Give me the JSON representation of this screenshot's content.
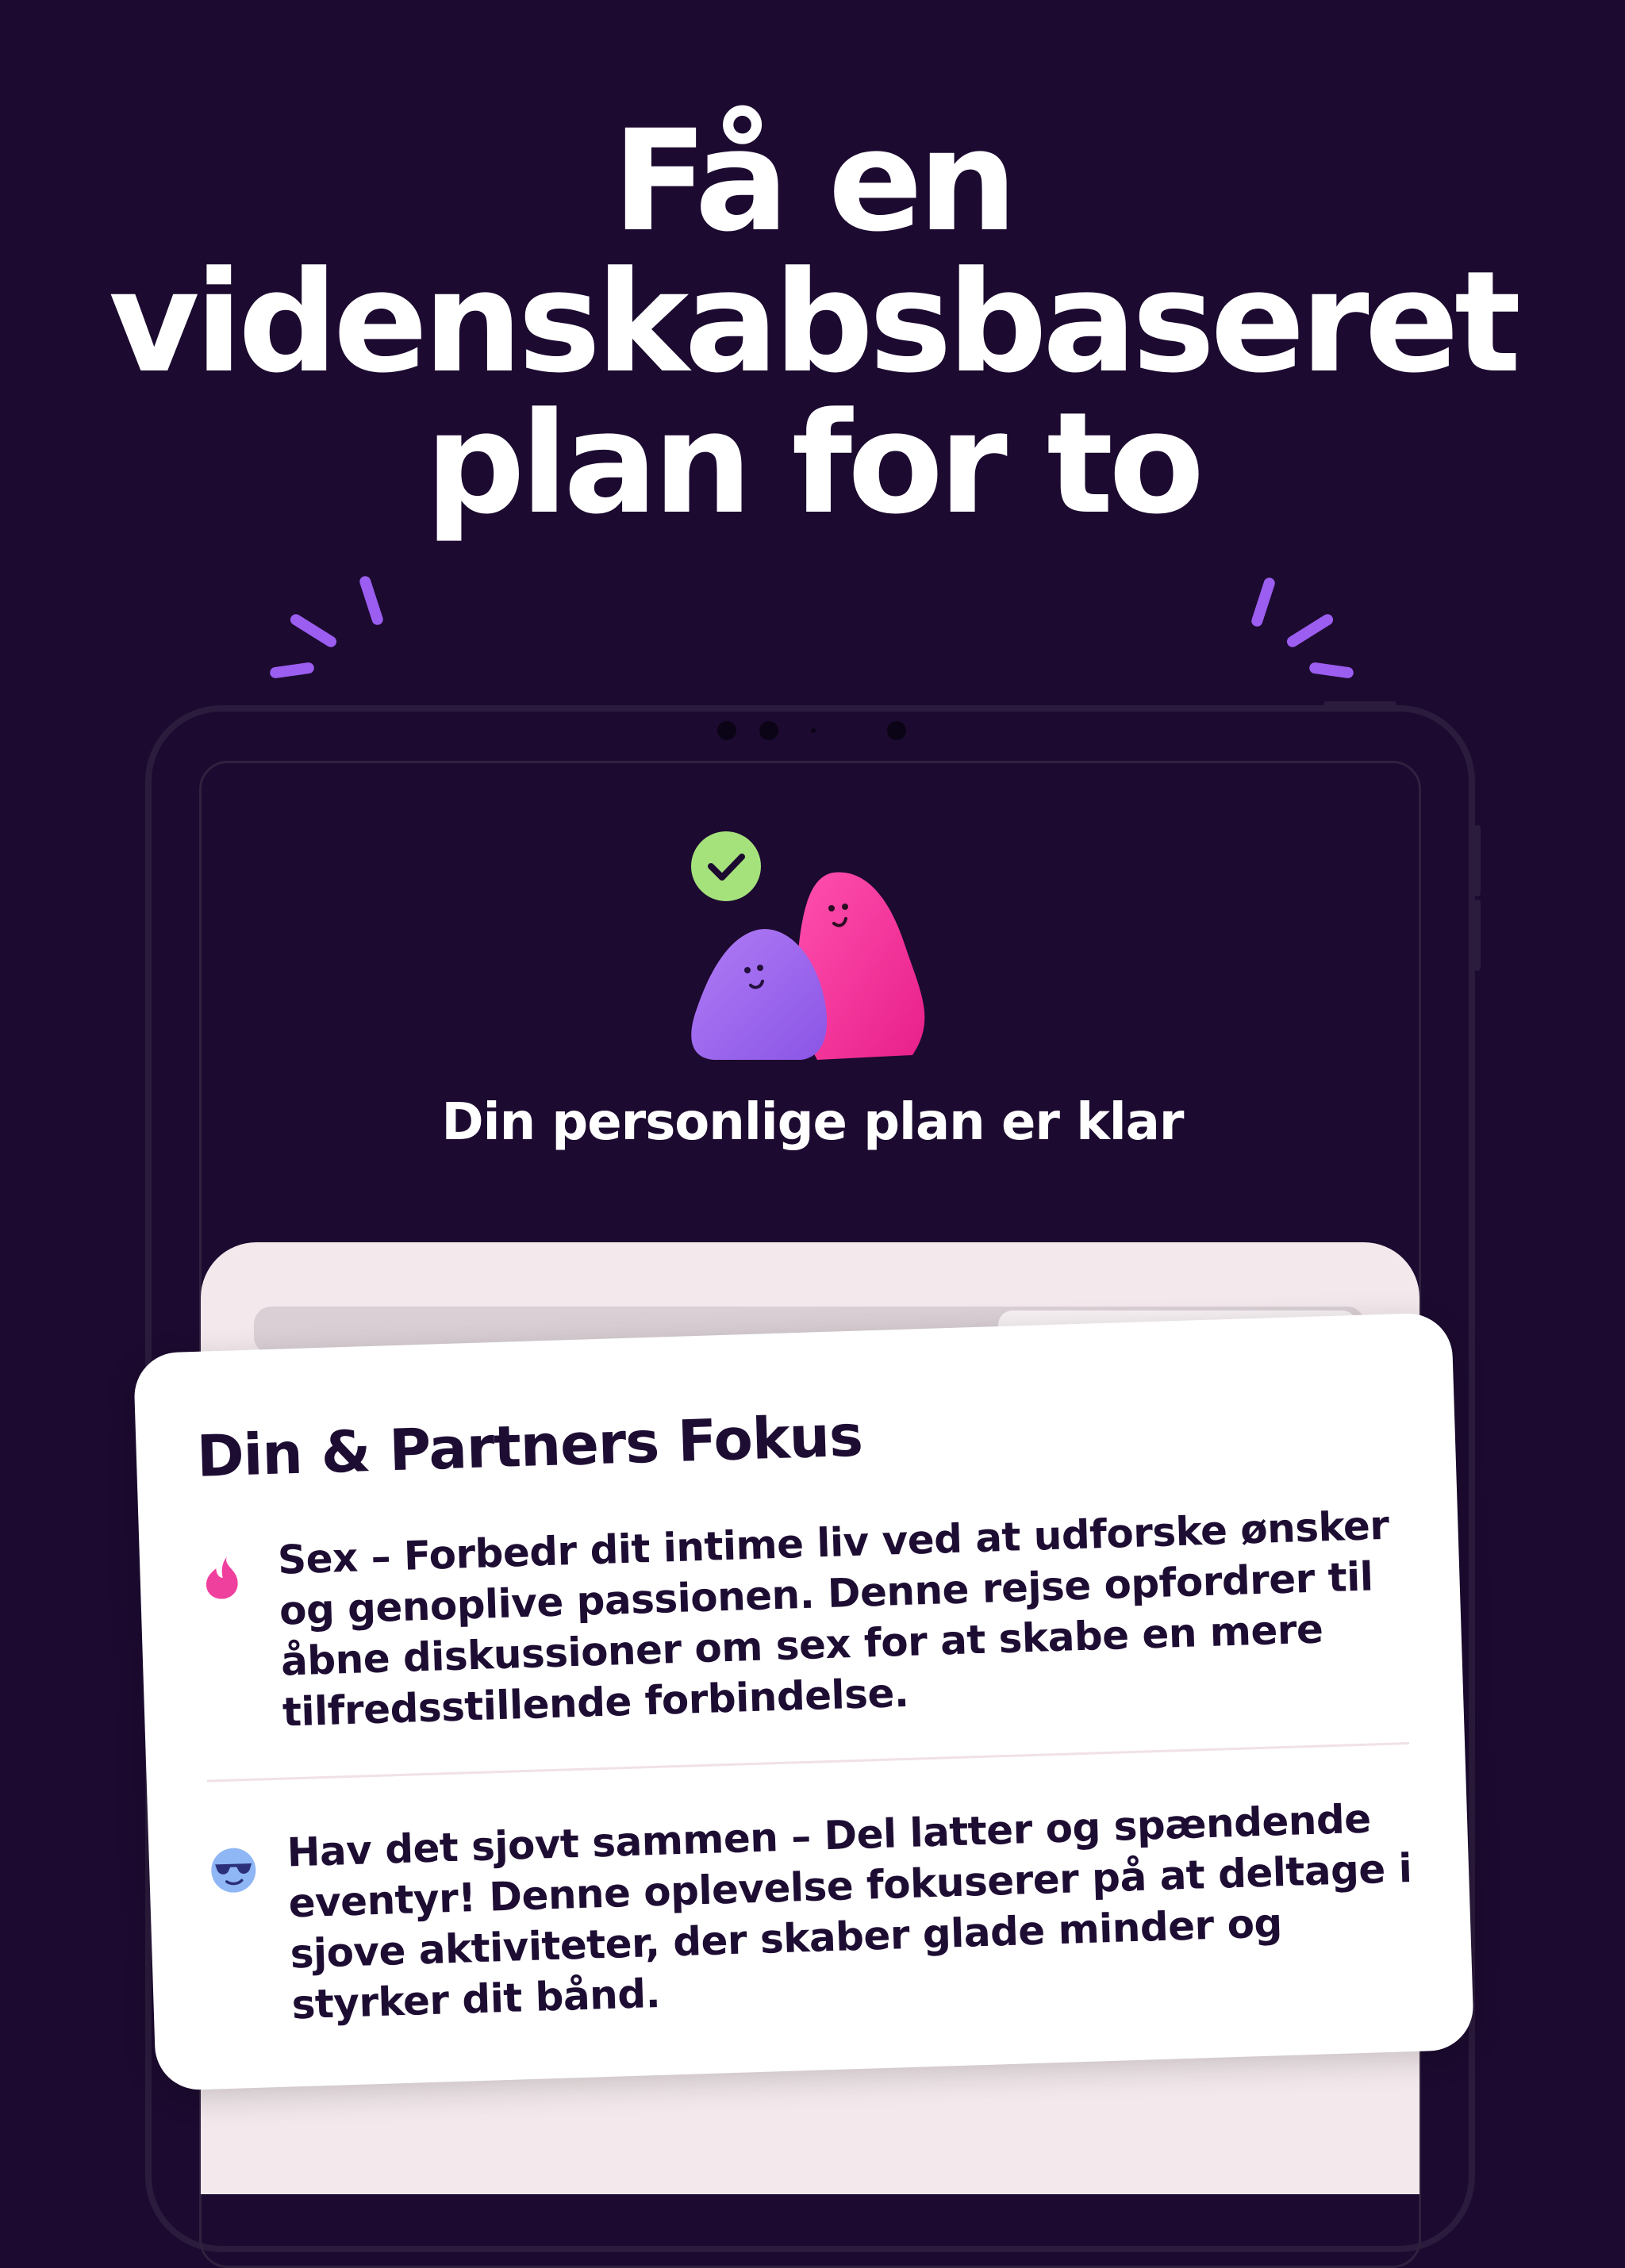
{
  "headline": {
    "line1": "Få en",
    "line2": "videnskabsbaseret",
    "line3": "plan for to"
  },
  "screen": {
    "status_text": "Din personlige plan er klar"
  },
  "focus_card": {
    "title": "Din & Partners Fokus",
    "items": [
      {
        "icon": "flame-icon",
        "text": "Sex – Forbedr dit intime liv ved at udforske ønsker og genoplive passionen. Denne rejse opfordrer til åbne diskussioner om sex for at skabe en mere tilfredsstillende forbindelse."
      },
      {
        "icon": "sunglasses-emoji-icon",
        "text": "Hav det sjovt sammen – Del latter og spændende eventyr! Denne oplevelse fokuserer på at deltage i sjove aktiviteter, der skaber glade minder og styrker dit bånd."
      }
    ]
  },
  "colors": {
    "background": "#1c0a30",
    "accent_purple": "#9b5ef0",
    "accent_pink": "#f23d9c",
    "check_green": "#9fe07a",
    "card_text": "#1e0d33"
  }
}
